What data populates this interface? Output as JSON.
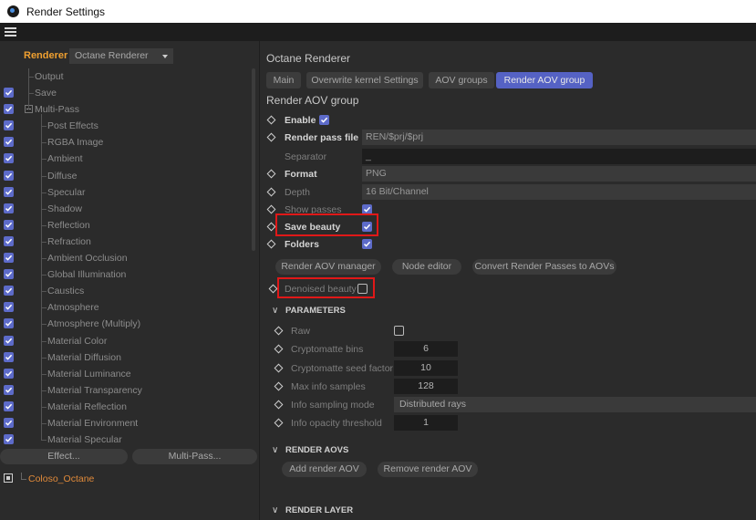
{
  "window": {
    "title": "Render Settings"
  },
  "left": {
    "renderer_label": "Renderer",
    "renderer_value": "Octane Renderer",
    "tree": [
      {
        "label": "Output",
        "checked": false,
        "level": 1
      },
      {
        "label": "Save",
        "checked": true,
        "level": 1
      },
      {
        "label": "Multi-Pass",
        "checked": true,
        "level": 1,
        "expander": true
      },
      {
        "label": "Post Effects",
        "checked": true,
        "level": 2
      },
      {
        "label": "RGBA Image",
        "checked": true,
        "level": 2
      },
      {
        "label": "Ambient",
        "checked": true,
        "level": 2
      },
      {
        "label": "Diffuse",
        "checked": true,
        "level": 2
      },
      {
        "label": "Specular",
        "checked": true,
        "level": 2
      },
      {
        "label": "Shadow",
        "checked": true,
        "level": 2
      },
      {
        "label": "Reflection",
        "checked": true,
        "level": 2
      },
      {
        "label": "Refraction",
        "checked": true,
        "level": 2
      },
      {
        "label": "Ambient Occlusion",
        "checked": true,
        "level": 2
      },
      {
        "label": "Global Illumination",
        "checked": true,
        "level": 2
      },
      {
        "label": "Caustics",
        "checked": true,
        "level": 2
      },
      {
        "label": "Atmosphere",
        "checked": true,
        "level": 2
      },
      {
        "label": "Atmosphere (Multiply)",
        "checked": true,
        "level": 2
      },
      {
        "label": "Material Color",
        "checked": true,
        "level": 2
      },
      {
        "label": "Material Diffusion",
        "checked": true,
        "level": 2
      },
      {
        "label": "Material Luminance",
        "checked": true,
        "level": 2
      },
      {
        "label": "Material Transparency",
        "checked": true,
        "level": 2
      },
      {
        "label": "Material Reflection",
        "checked": true,
        "level": 2
      },
      {
        "label": "Material Environment",
        "checked": true,
        "level": 2
      },
      {
        "label": "Material Specular",
        "checked": true,
        "level": 2
      }
    ],
    "effect_button": "Effect...",
    "multipass_button": "Multi-Pass...",
    "scene_item": "Coloso_Octane"
  },
  "right": {
    "title": "Octane Renderer",
    "tabs": [
      "Main",
      "Overwrite kernel Settings",
      "AOV groups",
      "Render AOV group"
    ],
    "active_tab": 3,
    "subtitle": "Render AOV group",
    "enable_label": "Enable",
    "render_pass_file_label": "Render pass file",
    "render_pass_file_value": "REN/$prj/$prj",
    "separator_label": "Separator",
    "separator_value": "_",
    "format_label": "Format",
    "format_value": "PNG",
    "depth_label": "Depth",
    "depth_value": "16 Bit/Channel",
    "show_passes_label": "Show passes",
    "save_beauty_label": "Save beauty",
    "folders_label": "Folders",
    "btn_render_aov_manager": "Render AOV manager",
    "btn_node_editor": "Node editor",
    "btn_convert": "Convert Render Passes to AOVs",
    "denoised_beauty_label": "Denoised beauty",
    "parameters_title": "PARAMETERS",
    "params": {
      "raw_label": "Raw",
      "cryptomatte_bins_label": "Cryptomatte bins",
      "cryptomatte_bins_value": "6",
      "cryptomatte_seed_label": "Cryptomatte seed factor",
      "cryptomatte_seed_value": "10",
      "max_info_samples_label": "Max info samples",
      "max_info_samples_value": "128",
      "info_sampling_mode_label": "Info sampling mode",
      "info_sampling_mode_value": "Distributed rays",
      "info_opacity_threshold_label": "Info opacity threshold",
      "info_opacity_threshold_value": "1"
    },
    "render_aovs_title": "RENDER AOVS",
    "btn_add_render_aov": "Add render AOV",
    "btn_remove_render_aov": "Remove render AOV",
    "render_layer_title": "RENDER LAYER"
  }
}
